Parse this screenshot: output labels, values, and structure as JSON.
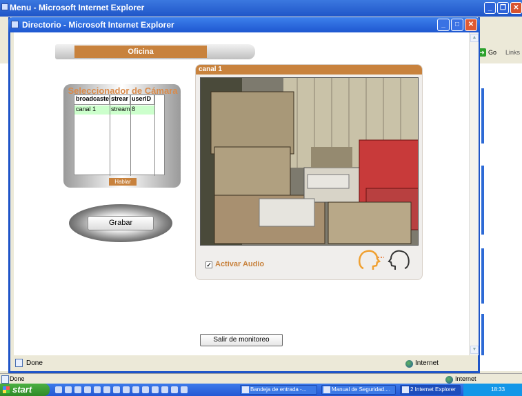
{
  "outer_window": {
    "title": "Menu - Microsoft Internet Explorer",
    "go_label": "Go",
    "links_label": "Links",
    "status": "Done",
    "zone": "Internet"
  },
  "inner_window": {
    "title": "Directorio - Microsoft Internet Explorer",
    "status": "Done",
    "zone": "Internet"
  },
  "page": {
    "section_tab": "Oficina",
    "selector": {
      "title": "Seleccionador de Cámara",
      "columns": [
        "broadcaste",
        "strear",
        "userID"
      ],
      "rows": [
        [
          "canal 1",
          "stream",
          "8"
        ]
      ],
      "talk_button": "Hablar"
    },
    "record_button": "Grabar",
    "camera": {
      "title": "canal 1",
      "audio_label": "Activar Audio",
      "audio_checked": true
    },
    "exit_button": "Salir de monitoreo"
  },
  "taskbar": {
    "start_label": "start",
    "tasks": [
      {
        "label": "Bandeja de entrada -..."
      },
      {
        "label": "Manual de Seguridad...."
      },
      {
        "label": "2 Internet Explorer"
      }
    ],
    "clock": "18:33"
  }
}
